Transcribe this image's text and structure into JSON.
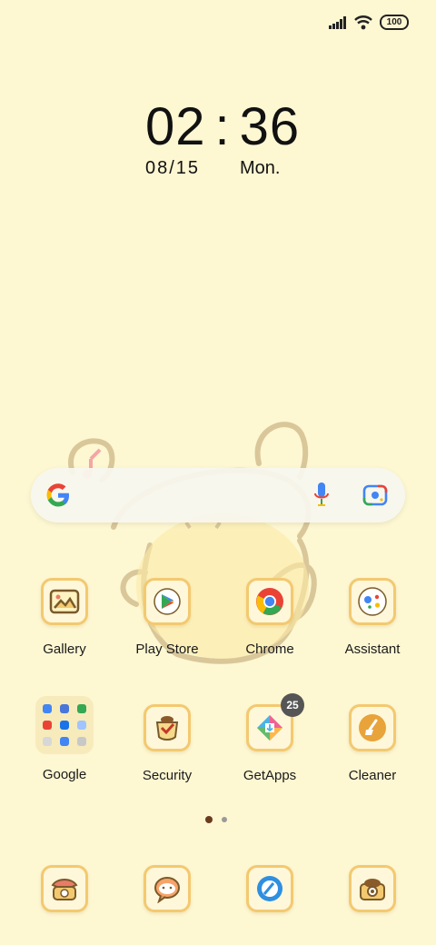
{
  "status": {
    "battery": "100"
  },
  "clock": {
    "hours": "02",
    "minutes": "36",
    "separator": ":",
    "date": "08/15",
    "weekday": "Mon."
  },
  "apps_row1": [
    {
      "label": "Gallery"
    },
    {
      "label": "Play Store"
    },
    {
      "label": "Chrome"
    },
    {
      "label": "Assistant"
    }
  ],
  "apps_row2": [
    {
      "label": "Google"
    },
    {
      "label": "Security"
    },
    {
      "label": "GetApps",
      "badge": "25"
    },
    {
      "label": "Cleaner"
    }
  ],
  "dock": [
    {
      "icon": "phone-icon"
    },
    {
      "icon": "messaging-icon"
    },
    {
      "icon": "browser-icon"
    },
    {
      "icon": "camera-icon"
    }
  ],
  "pages": {
    "count": 2,
    "current": 1
  },
  "colors": {
    "wallpaper": "#fdf7d2",
    "tile_border": "#f3c970",
    "accent_brown": "#6a3b1f"
  }
}
